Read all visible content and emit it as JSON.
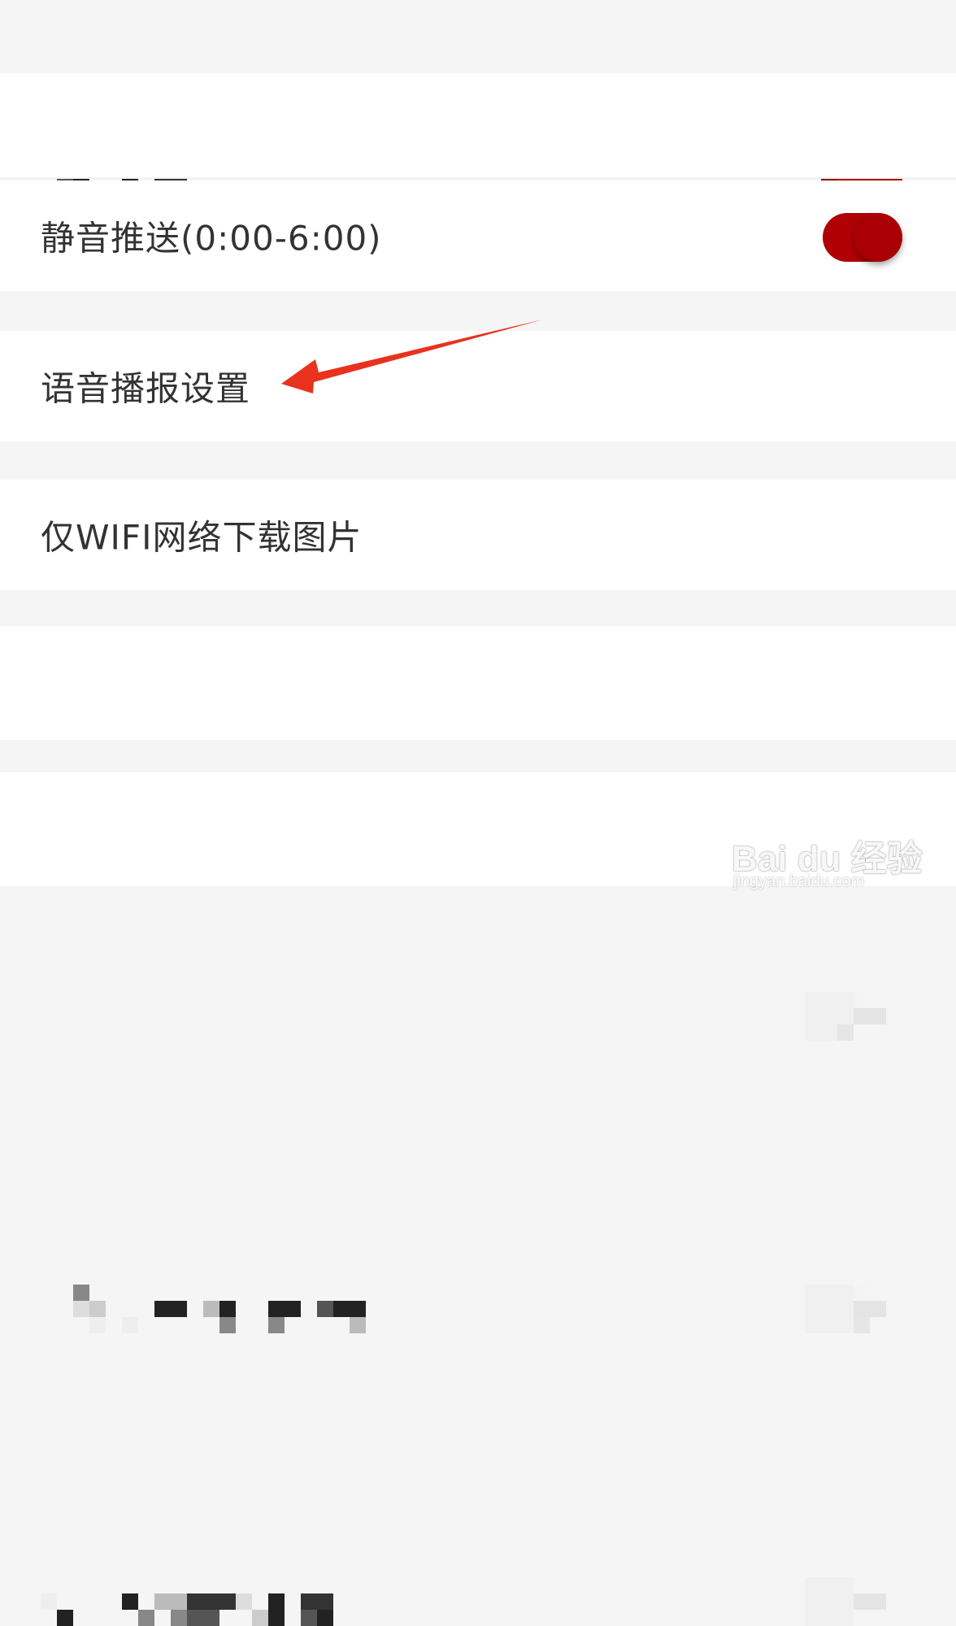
{
  "settings": {
    "rows": [
      {
        "label": ""
      },
      {
        "label": "静音推送(0:00-6:00)"
      },
      {
        "label": "语音播报设置"
      },
      {
        "label": "仅WIFI网络下载图片"
      },
      {
        "label": ""
      },
      {
        "label": ""
      }
    ],
    "mute_push_toggle": {
      "state": "on",
      "color": "#b00006"
    }
  },
  "annotation": {
    "arrow_color": "#e8321e"
  },
  "watermark": {
    "logo": "Bai du 经验",
    "url": "jingyan.baidu.com"
  }
}
